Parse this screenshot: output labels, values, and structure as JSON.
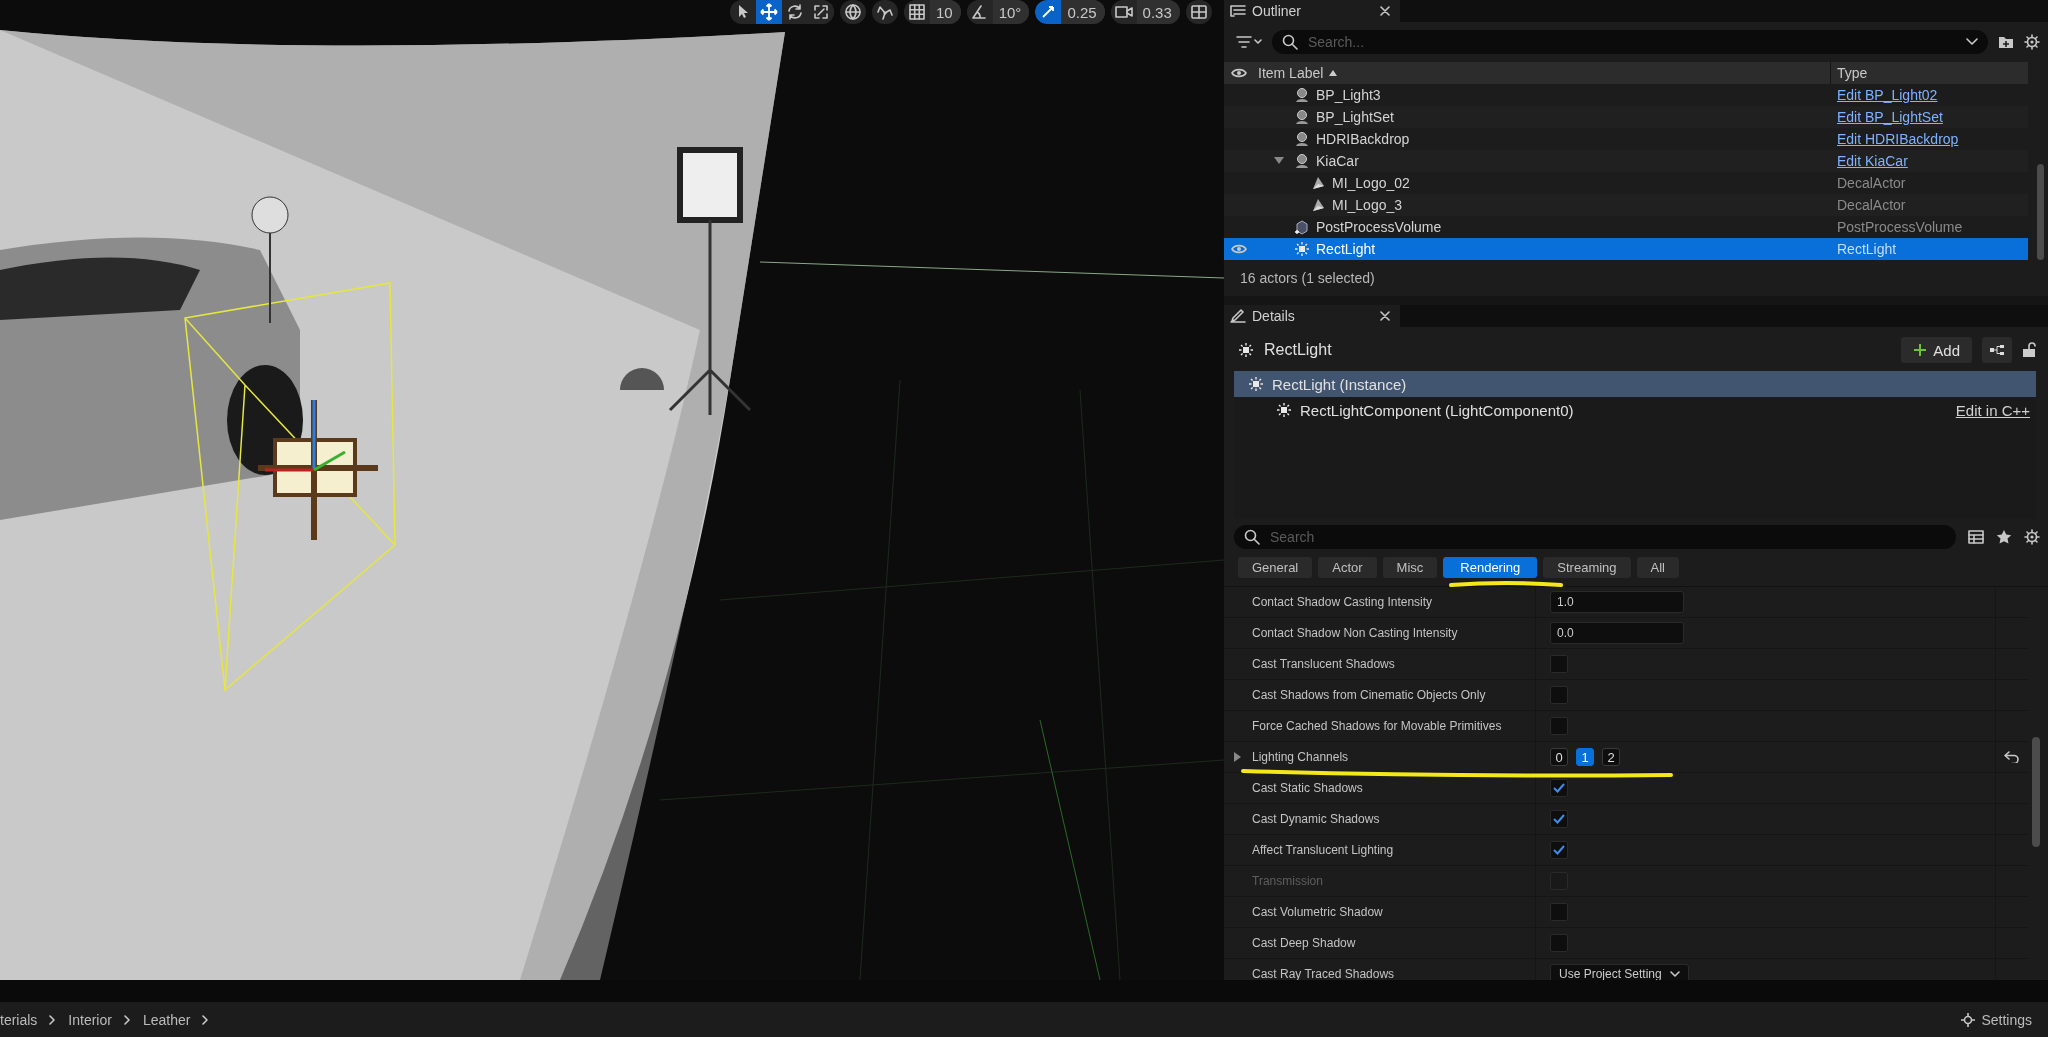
{
  "viewport": {
    "toolbar": {
      "tools": [
        {
          "kind": "select",
          "selected": false
        },
        {
          "kind": "translate",
          "selected": true
        },
        {
          "kind": "rotate",
          "selected": false
        },
        {
          "kind": "scale",
          "selected": false
        }
      ],
      "space": [
        {
          "kind": "world"
        },
        {
          "kind": "surface"
        }
      ],
      "snaps": [
        {
          "kind": "grid",
          "value": "10",
          "on": false
        },
        {
          "kind": "angle",
          "value": "10°",
          "on": false
        },
        {
          "kind": "scale",
          "value": "0.25",
          "on": true
        },
        {
          "kind": "camera",
          "value": "0.33",
          "on": false
        }
      ],
      "layout": {
        "kind": "layout"
      }
    }
  },
  "outliner": {
    "title": "Outliner",
    "search": {
      "placeholder": "Search..."
    },
    "columns": [
      "Item Label",
      "Type"
    ],
    "rows": [
      {
        "label": "BP_Light3",
        "kind": "actor",
        "type": "Edit BP_Light02",
        "type_link": true,
        "selected": false
      },
      {
        "label": "BP_LightSet",
        "kind": "actor",
        "type": "Edit BP_LightSet",
        "type_link": true,
        "selected": false
      },
      {
        "label": "HDRIBackdrop",
        "kind": "actor",
        "type": "Edit HDRIBackdrop",
        "type_link": true,
        "selected": false
      },
      {
        "label": "KiaCar",
        "kind": "actor",
        "type": "Edit KiaCar",
        "type_link": true,
        "selected": false,
        "expanded": true,
        "children": [
          {
            "label": "MI_Logo_02",
            "kind": "decal",
            "type": "DecalActor",
            "type_link": false,
            "selected": false
          },
          {
            "label": "MI_Logo_3",
            "kind": "decal",
            "type": "DecalActor",
            "type_link": false,
            "selected": false
          }
        ]
      },
      {
        "label": "PostProcessVolume",
        "kind": "volume",
        "type": "PostProcessVolume",
        "type_link": false,
        "selected": false
      },
      {
        "label": "RectLight",
        "kind": "light",
        "type": "RectLight",
        "type_link": false,
        "selected": true
      }
    ],
    "status": "16 actors (1 selected)"
  },
  "details": {
    "title": "Details",
    "actor": "RectLight",
    "add_button": "Add",
    "components": [
      {
        "label": "RectLight (Instance)",
        "selected": true,
        "children": [
          {
            "label": "RectLightComponent (LightComponent0)",
            "selected": false,
            "link": "Edit in C++"
          }
        ]
      }
    ],
    "search": {
      "placeholder": "Search"
    },
    "filters": [
      {
        "label": "General",
        "selected": false
      },
      {
        "label": "Actor",
        "selected": false
      },
      {
        "label": "Misc",
        "selected": false
      },
      {
        "label": "Rendering",
        "selected": true
      },
      {
        "label": "Streaming",
        "selected": false
      },
      {
        "label": "All",
        "selected": false
      }
    ],
    "properties": [
      {
        "kind": "number",
        "name": "Contact Shadow Casting Intensity",
        "value": "1.0"
      },
      {
        "kind": "number",
        "name": "Contact Shadow Non Casting Intensity",
        "value": "0.0"
      },
      {
        "kind": "checkbox",
        "name": "Cast Translucent Shadows",
        "checked": false,
        "disabled": false
      },
      {
        "kind": "checkbox",
        "name": "Cast Shadows from Cinematic Objects Only",
        "checked": false,
        "disabled": false
      },
      {
        "kind": "checkbox",
        "name": "Force Cached Shadows for Movable Primitives",
        "checked": false,
        "disabled": false
      },
      {
        "kind": "channels",
        "name": "Lighting Channels",
        "expanded": false,
        "channels": [
          {
            "label": "0",
            "selected": false
          },
          {
            "label": "1",
            "selected": true
          },
          {
            "label": "2",
            "selected": false
          }
        ]
      },
      {
        "kind": "checkbox",
        "name": "Cast Static Shadows",
        "checked": true,
        "disabled": false
      },
      {
        "kind": "checkbox",
        "name": "Cast Dynamic Shadows",
        "checked": true,
        "disabled": false
      },
      {
        "kind": "checkbox",
        "name": "Affect Translucent Lighting",
        "checked": true,
        "disabled": false
      },
      {
        "kind": "checkbox",
        "name": "Transmission",
        "checked": false,
        "disabled": true
      },
      {
        "kind": "checkbox",
        "name": "Cast Volumetric Shadow",
        "checked": false,
        "disabled": false
      },
      {
        "kind": "checkbox",
        "name": "Cast Deep Shadow",
        "checked": false,
        "disabled": false
      },
      {
        "kind": "dropdown",
        "name": "Cast Ray Traced Shadows",
        "value": "Use Project Setting"
      }
    ]
  },
  "bottom_bar": {
    "breadcrumbs": [
      "terials",
      "Interior",
      "Leather"
    ],
    "settings": "Settings"
  }
}
